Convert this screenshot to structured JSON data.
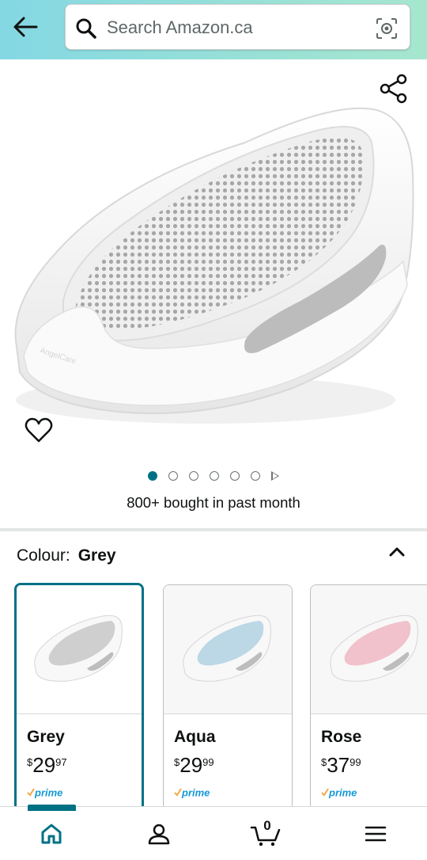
{
  "search": {
    "placeholder": "Search Amazon.ca"
  },
  "product": {
    "bought_text": "800+ bought in past month",
    "image_count": 6,
    "active_image_index": 0
  },
  "colour": {
    "label": "Colour:",
    "selected": "Grey",
    "options": [
      {
        "name": "Grey",
        "currency": "$",
        "whole": "29",
        "fraction": "97",
        "prime": "prime",
        "tint": "#d9d9d9"
      },
      {
        "name": "Aqua",
        "currency": "$",
        "whole": "29",
        "fraction": "99",
        "prime": "prime",
        "tint": "#bcd7e6"
      },
      {
        "name": "Rose",
        "currency": "$",
        "whole": "37",
        "fraction": "99",
        "prime": "prime",
        "tint": "#f1c2cb"
      }
    ]
  },
  "nav": {
    "cart_count": "0"
  },
  "colors": {
    "accent": "#007185",
    "prime_blue": "#1399d6",
    "prime_check": "#f3a847"
  }
}
